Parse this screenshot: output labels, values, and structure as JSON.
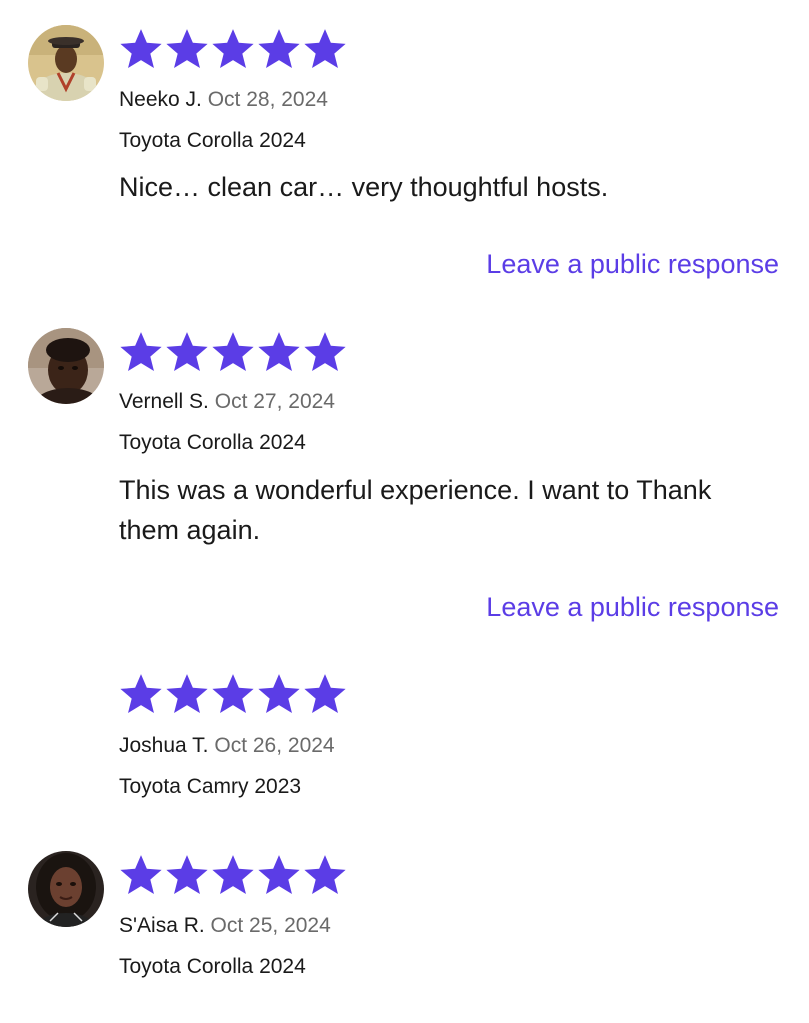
{
  "theme": {
    "accent": "#5b3de6",
    "star_color": "#5b3de6",
    "date_color": "#6a6a6a",
    "text_color": "#1a1a1a"
  },
  "reviews": [
    {
      "rating": 5,
      "name": "Neeko J.",
      "date": "Oct 28, 2024",
      "vehicle": "Toyota Corolla 2024",
      "comment": "Nice… clean car… very thoughtful hosts.",
      "response_link": "Leave a public response",
      "avatar": "avatar-photo"
    },
    {
      "rating": 5,
      "name": "Vernell S.",
      "date": "Oct 27, 2024",
      "vehicle": "Toyota Corolla 2024",
      "comment": "This was a wonderful experience. I want to Thank them again.",
      "response_link": "Leave a public response",
      "avatar": "avatar-photo"
    },
    {
      "rating": 5,
      "name": "Joshua T.",
      "date": "Oct 26, 2024",
      "vehicle": "Toyota Camry 2023",
      "avatar": "none"
    },
    {
      "rating": 5,
      "name": "S'Aisa R.",
      "date": "Oct 25, 2024",
      "vehicle": "Toyota Corolla 2024",
      "avatar": "avatar-photo"
    }
  ]
}
